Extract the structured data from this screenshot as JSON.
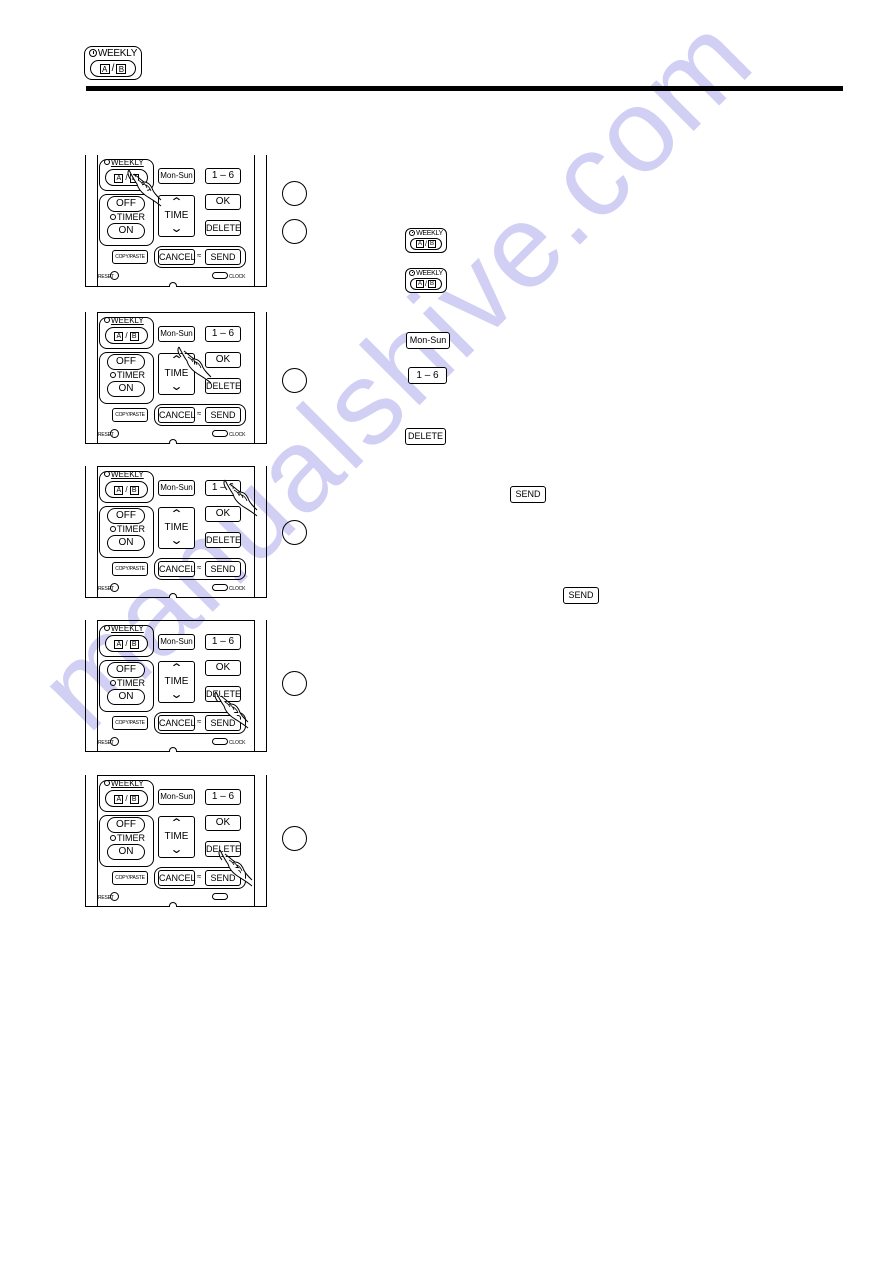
{
  "header": {
    "icon": {
      "name": "weekly-ab-button-icon",
      "top_label": "WEEKLY",
      "clock_icon": "timer-clock-icon",
      "a_label": "A",
      "slash": "/",
      "b_label": "B"
    }
  },
  "remote": {
    "weekly_label": "WEEKLY",
    "a_label": "A",
    "slash": "/",
    "b_label": "B",
    "mon_sun": "Mon-Sun",
    "one_six": "1 – 6",
    "off": "OFF",
    "timer": "TIMER",
    "on": "ON",
    "time": "TIME",
    "up": "^",
    "down": "v",
    "ok": "OK",
    "delete": "DELETE",
    "copy_paste": "COPY/PASTE",
    "cancel": "CANCEL",
    "send": "SEND",
    "reset": "RESET",
    "clock": "CLOCK"
  },
  "remotes": [
    {
      "pressed": "weekly-ab",
      "show_clock_label": true
    },
    {
      "pressed": "mon-sun",
      "show_clock_label": true
    },
    {
      "pressed": "1-6",
      "show_clock_label": true
    },
    {
      "pressed": "delete",
      "show_clock_label": true
    },
    {
      "pressed": "send",
      "show_clock_label": false
    }
  ],
  "steps": [
    {
      "number": ""
    },
    {
      "number": ""
    },
    {
      "number": ""
    },
    {
      "number": ""
    },
    {
      "number": ""
    },
    {
      "number": ""
    }
  ],
  "inline_icons": {
    "weekly_1": {
      "top_label": "WEEKLY",
      "a_label": "A",
      "slash": "/",
      "b_label": "B"
    },
    "weekly_2": {
      "top_label": "WEEKLY",
      "a_label": "A",
      "slash": "/",
      "b_label": "B"
    },
    "mon_sun": "Mon-Sun",
    "one_six": "1 – 6",
    "delete": "DELETE",
    "send_1": "SEND",
    "send_2": "SEND"
  },
  "watermark": "manualshive.com"
}
